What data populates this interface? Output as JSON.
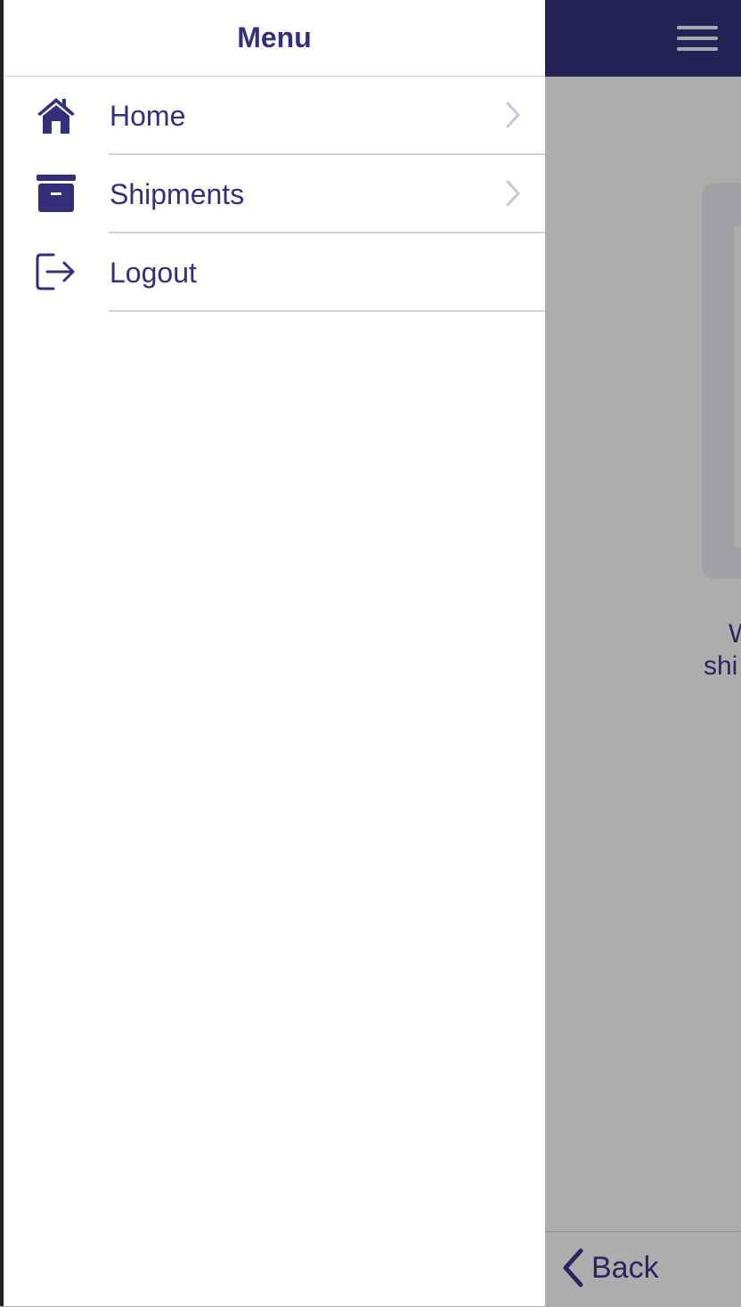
{
  "drawer": {
    "title": "Menu",
    "items": [
      {
        "label": "Home",
        "icon": "home-icon",
        "has_chevron": true
      },
      {
        "label": "Shipments",
        "icon": "archive-box-icon",
        "has_chevron": true
      },
      {
        "label": "Logout",
        "icon": "logout-icon",
        "has_chevron": false
      }
    ]
  },
  "background": {
    "text_line1": "W",
    "text_line2": "shi",
    "back_label": "Back"
  },
  "colors": {
    "brand": "#272256",
    "text": "#352f7a",
    "overlay": "#adadad"
  }
}
